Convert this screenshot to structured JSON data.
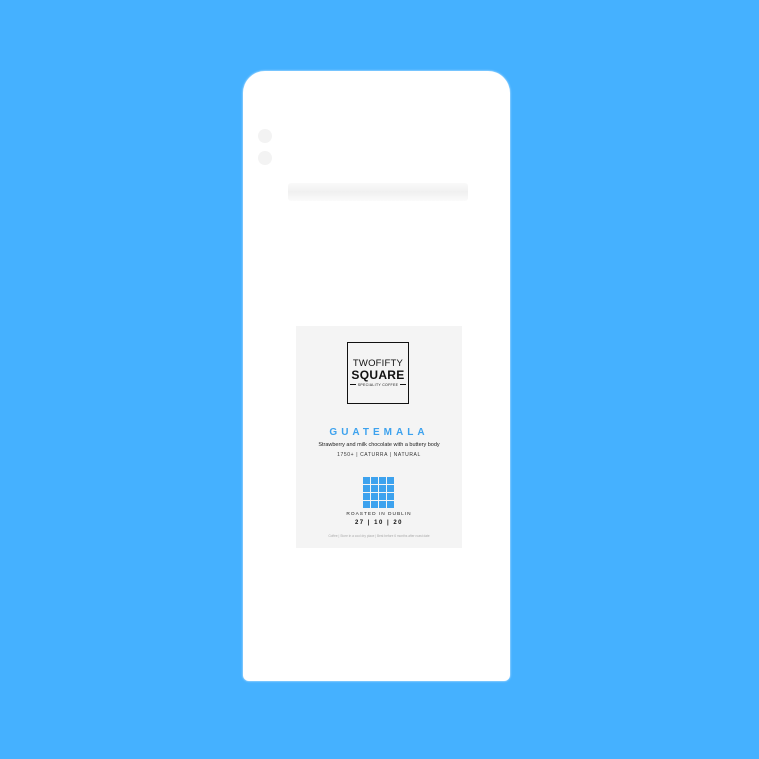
{
  "brand": {
    "line1": "TWOFIFTY",
    "line2": "SQUARE",
    "line3": "SPECIALITY COFFEE"
  },
  "coffee": {
    "origin": "GUATEMALA",
    "tasting_notes": "Strawberry and milk chocolate with a buttery body",
    "specs": "1750+ | CATURRA | NATURAL"
  },
  "roast": {
    "location": "ROASTED IN DUBLIN",
    "date": "27 | 10 | 20"
  },
  "fine_print": "Coffee | Store in a cool dry place | Best before 6 months after roast date",
  "colors": {
    "background": "#45b1ff",
    "accent": "#3da2ee",
    "bag": "#ffffff"
  }
}
